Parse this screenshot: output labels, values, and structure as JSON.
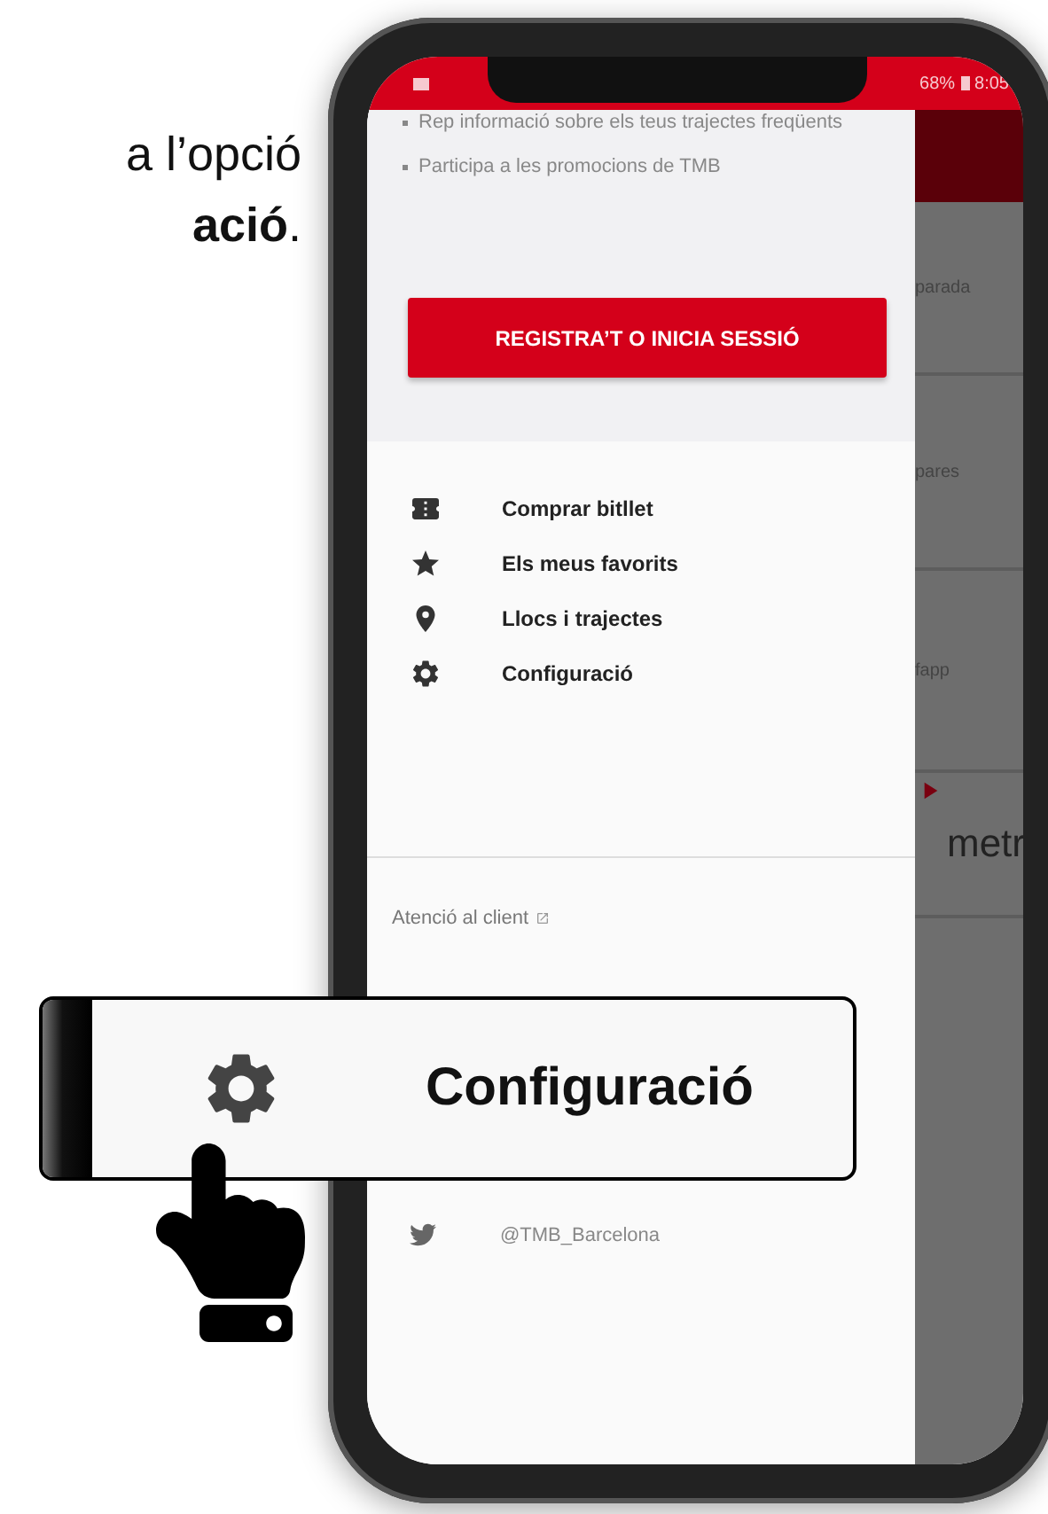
{
  "instruction": {
    "lines": [
      "a l’opció",
      "**ació**."
    ]
  },
  "status_bar": {
    "battery": "68%",
    "time": "8:05"
  },
  "drawer": {
    "bullets": [
      "Rep informació sobre els teus trajectes freqüents",
      "Participa a les promocions de TMB"
    ],
    "button": "REGISTRA’T O INICIA SESSIÓ",
    "menu": [
      {
        "label": "Comprar bitllet"
      },
      {
        "label": "Els meus favorits"
      },
      {
        "label": "Llocs i trajectes"
      },
      {
        "label": "Configuració"
      }
    ],
    "support_link": "Atenció al client",
    "social": {
      "handle": "@TMB_Barcelona"
    }
  },
  "background_items": [
    {
      "text": "parada",
      "kind": "faded"
    },
    {
      "text": "pares",
      "kind": "faded"
    },
    {
      "text": "fapp",
      "kind": "faded"
    },
    {
      "text": "metr",
      "kind": "bold"
    }
  ],
  "callout": {
    "label": "Configuració"
  }
}
